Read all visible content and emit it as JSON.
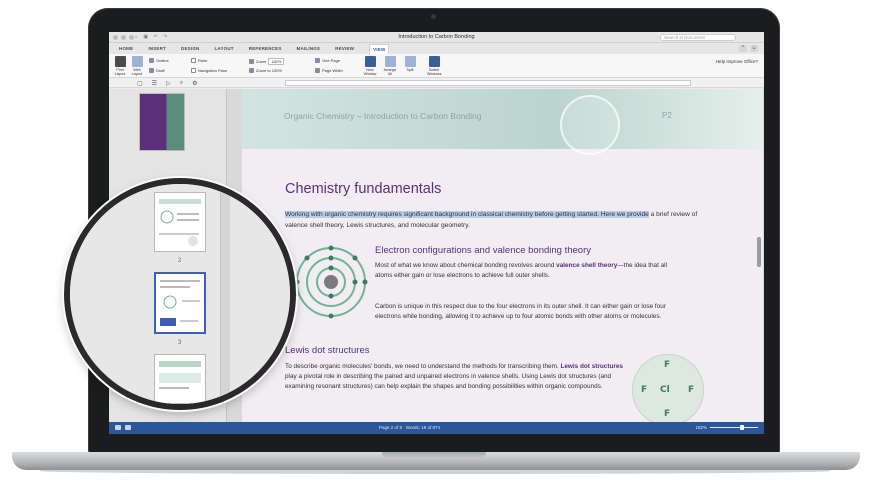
{
  "window": {
    "title": "Introduction to Carbon Bonding",
    "search_placeholder": "Search in Document",
    "help_text": "Help Improve Office?"
  },
  "ribbon": {
    "tabs": [
      "HOME",
      "INSERT",
      "DESIGN",
      "LAYOUT",
      "REFERENCES",
      "MAILINGS",
      "REVIEW",
      "VIEW"
    ],
    "active_tab": "VIEW",
    "views": {
      "print_layout": "Print Layout",
      "web_layout": "Web Layout",
      "outline": "Outline",
      "draft": "Draft"
    },
    "show": {
      "ruler": "Ruler",
      "navigation_pane": "Navigation Pane"
    },
    "zoom": {
      "zoom_label": "Zoom",
      "zoom_value": "182%",
      "zoom_100": "Zoom to 100%",
      "one_page": "One Page",
      "page_width": "Page Width"
    },
    "window_group": {
      "new_window": "New Window",
      "arrange_all": "Arrange All",
      "split": "Split",
      "switch_windows": "Switch Windows"
    }
  },
  "document": {
    "header_text": "Organic Chemistry – Introduction to Carbon Bonding",
    "header_page": "P2",
    "heading": "Chemistry fundamentals",
    "intro_selected": "Working with organic chemistry requires significant background in classical chemistry before getting started. Here we provide",
    "intro_rest": " a brief review of valence shell theory, Lewis structures, and molecular geometry.",
    "section1_heading": "Electron configurations and valence bonding theory",
    "section1_p1_a": "Most of what we know about chemical bonding revolves around ",
    "section1_p1_kw": "valence shell theory",
    "section1_p1_b": "—the idea that all atoms either gain or lose electrons to achieve full outer shells.",
    "section1_p2": "Carbon is unique in this respect due to the four electrons in its outer shell. It can either gain or lose four electrons while bonding, allowing it to achieve up to four atomic bonds with other atoms or molecules.",
    "section2_heading": "Lewis dot structures",
    "section2_p_a": "To describe organic molecules' bonds, we need to understand the methods for transcribing them. ",
    "section2_p_kw": "Lewis dot structures",
    "section2_p_b": " play a pivotal role in describing the paired and unpaired electrons in valence shells. Using Lewis dot structures (and examining resonant structures) can help explain the shapes and bonding possibilities within organic compounds.",
    "lewis": {
      "center": "Cl",
      "top": "F",
      "left": "F",
      "right": "F",
      "bottom": "F"
    }
  },
  "thumbnails": {
    "page_numbers": [
      "2",
      "3"
    ]
  },
  "statusbar": {
    "page_info": "Page 2 of 8",
    "word_info": "Words: 18 of 874",
    "zoom": "182%"
  },
  "colors": {
    "accent": "#2b579a",
    "heading_purple": "#5b2f7a",
    "keyword_purple": "#5b2f7a",
    "page_tint": "#f1edf3"
  }
}
